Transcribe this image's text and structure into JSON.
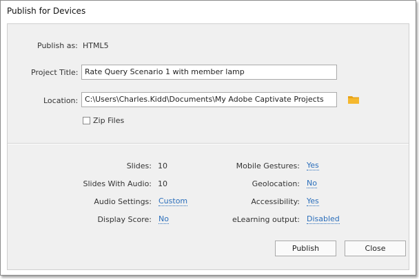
{
  "window": {
    "title": "Publish for Devices"
  },
  "publish_as": {
    "label": "Publish as:",
    "value": "HTML5"
  },
  "project_title": {
    "label": "Project Title:",
    "value": "Rate Query Scenario 1 with member lamp"
  },
  "location": {
    "label": "Location:",
    "value": "C:\\Users\\Charles.Kidd\\Documents\\My Adobe Captivate Projects"
  },
  "zip_files": {
    "label": "Zip Files",
    "checked": false
  },
  "summary_left": [
    {
      "label": "Slides:",
      "value": "10"
    },
    {
      "label": "Slides With Audio:",
      "value": "10"
    },
    {
      "label": "Audio Settings:",
      "value": "Custom"
    },
    {
      "label": "Display Score:",
      "value": "No"
    }
  ],
  "summary_right": [
    {
      "label": "Mobile Gestures:",
      "value": "Yes"
    },
    {
      "label": "Geolocation:",
      "value": "No"
    },
    {
      "label": "Accessibility:",
      "value": "Yes"
    },
    {
      "label": "eLearning output:",
      "value": "Disabled"
    }
  ],
  "buttons": {
    "publish": "Publish",
    "close": "Close"
  },
  "colors": {
    "link": "#2a6ebb",
    "folder": "#e8a317",
    "panel": "#f0f0f0"
  }
}
